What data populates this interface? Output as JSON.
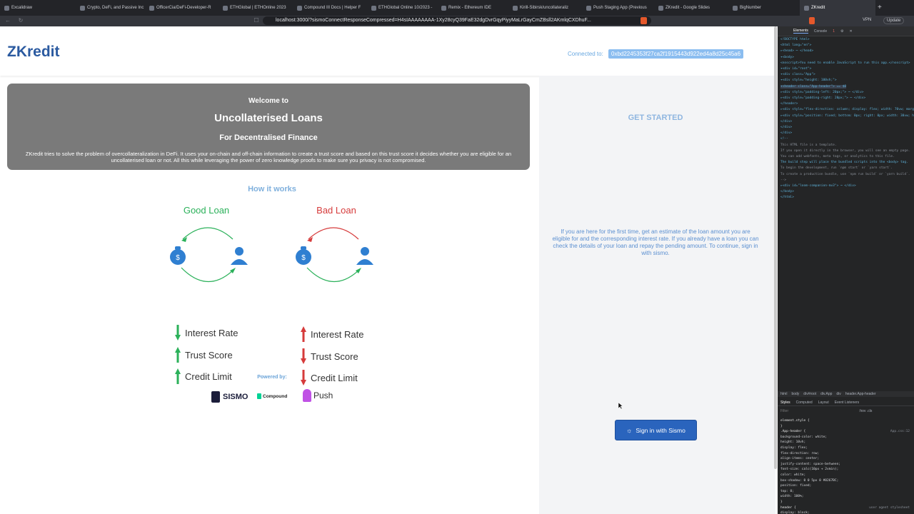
{
  "browser": {
    "tabs": [
      {
        "label": "Excalidraw",
        "active": false
      },
      {
        "label": "Crypto, DeFi, and Passive Inc",
        "active": false
      },
      {
        "label": "OfficerCia/DeFi-Developer-R",
        "active": false
      },
      {
        "label": "ETHGlobal | ETHOnline 2023",
        "active": false
      },
      {
        "label": "Compound III Docs | Helper F",
        "active": false
      },
      {
        "label": "ETHGlobal Online 10/2023 -",
        "active": false
      },
      {
        "label": "Remix - Ethereum IDE",
        "active": false
      },
      {
        "label": "Kirill-Sibirsk/uncollateraliz",
        "active": false
      },
      {
        "label": "Push Staging App (Previous",
        "active": false
      },
      {
        "label": "ZKredit - Google Slides",
        "active": false
      },
      {
        "label": "BigNumber",
        "active": false
      },
      {
        "label": "ZKredit",
        "active": true
      }
    ],
    "new_tab": "+",
    "url": "localhost:3000/?sismoConnectResponseCompressed=H4sIAAAAAAAA-1Xy28cyQ39FaE32dgDvrGqyPiyyMaLrGayCmZBsll2AKmlqCXDhuF...",
    "vpn_label": "VPN",
    "update_label": "Update"
  },
  "app": {
    "logo": "ZKredit",
    "connected_label": "Connected to:",
    "connected_address": "0xbd2245353f27ca2f1915443d922ed4a8d25c45a6",
    "welcome": {
      "pre": "Welcome to",
      "title": "Uncollaterised Loans",
      "subtitle": "For Decentralised Finance",
      "body": "ZKredit tries to solve the problem of overcollateralization in DeFi. It uses your on-chain and off-chain information to create a trust score and based on this trust score it decides whether you are eligible for an uncollaterised loan or not. All this while leveraging the power of zero knowledge proofs to make sure you privacy is not compromised."
    },
    "how_it_works": "How it works",
    "good": {
      "title": "Good Loan",
      "color": "#2bb15a",
      "metrics": [
        {
          "label": "Interest Rate",
          "direction": "down",
          "color": "#2bb15a"
        },
        {
          "label": "Trust Score",
          "direction": "up",
          "color": "#2bb15a"
        },
        {
          "label": "Credit Limit",
          "direction": "up",
          "color": "#2bb15a"
        }
      ]
    },
    "bad": {
      "title": "Bad Loan",
      "color": "#d63b3b",
      "metrics": [
        {
          "label": "Interest Rate",
          "direction": "up",
          "color": "#d63b3b"
        },
        {
          "label": "Trust Score",
          "direction": "down",
          "color": "#d63b3b"
        },
        {
          "label": "Credit Limit",
          "direction": "down",
          "color": "#d63b3b"
        }
      ]
    },
    "powered_by": "Powered by:",
    "sponsors": [
      "SISMO",
      "Compound",
      "Push"
    ],
    "get_started": "GET STARTED",
    "info": "If you are here for the first time, get an estimate of the loan amount you are eligible for and the corresponding interest rate. If you already have a loan you can check the details of your loan and repay the pending amount. To continue, sign in with sismo.",
    "signin": "Sign in with Sismo"
  },
  "devtools": {
    "tabs": [
      "Elements",
      "Console"
    ],
    "error_count": "1",
    "lines": [
      "<!DOCTYPE html>",
      "<html lang=\"en\">",
      "▸<head> ⋯ </head>",
      "▾<body>",
      "  <noscript>You need to enable JavaScript to run this app.</noscript>",
      "  ▾<div id=\"root\">",
      "   ▾<div class=\"App\">",
      "    ▾<div style=\"height: 100vh;\">",
      "     ▾<header class=\"App-header\"> == $0",
      "      ▸<div style=\"padding-left: 20px;\"> ⋯ </div>",
      "      ▸<div style=\"padding-right: 20px;\"> ⋯ </div>",
      "      </header>",
      "     ▸<div style=\"flex-direction: column; display: flex; width: 70vw; margin-top: 10vh;\">",
      "     ▸<div style=\"position: fixed; bottom: 0px; right: 0px; width: 30vw; height: 90vh;\">",
      "     </div>",
      "    </div>",
      "   </div>",
      "  <!--",
      "     This HTML file is a template.",
      "     If you open it directly in the browser, you will see an empty page.",
      "     You can add webfonts, meta tags, or analytics to this file.",
      "     The build step will place the bundled scripts into the <body> tag.",
      "     To begin the development, run `npm start` or `yarn start`.",
      "     To create a production bundle, use `npm run build` or `yarn build`.",
      "  -->",
      "  ▸<div id=\"loom-companion-mv3\"> ⋯ </div>",
      " </body>",
      "</html>"
    ],
    "crumbs": [
      "html",
      "body",
      "div#root",
      "div.App",
      "div",
      "header.App-header"
    ],
    "subtabs": [
      "Styles",
      "Computed",
      "Layout",
      "Event Listeners"
    ],
    "filter": "Filter",
    "filter_opts": ":hov .cls",
    "css": [
      {
        "text": "element.style {",
        "kind": "sel"
      },
      {
        "text": "}",
        "kind": "sel"
      },
      {
        "text": ".App-header {",
        "kind": "sel",
        "src": "App.css:12"
      },
      {
        "text": "  background-color: white;",
        "kind": "prop"
      },
      {
        "text": "  height: 10vh;",
        "kind": "prop"
      },
      {
        "text": "  display: flex;",
        "kind": "prop"
      },
      {
        "text": "  flex-direction: row;",
        "kind": "prop"
      },
      {
        "text": "  align-items: center;",
        "kind": "prop"
      },
      {
        "text": "  justify-content: space-between;",
        "kind": "prop"
      },
      {
        "text": "  font-size: calc(10px + 2vmin);",
        "kind": "prop"
      },
      {
        "text": "  color: white;",
        "kind": "prop"
      },
      {
        "text": "  box-shadow: 0 0 5px 0 #0267BC;",
        "kind": "prop"
      },
      {
        "text": "  position: fixed;",
        "kind": "prop"
      },
      {
        "text": "  top: 0;",
        "kind": "prop"
      },
      {
        "text": "  width: 100%;",
        "kind": "prop"
      },
      {
        "text": "}",
        "kind": "sel"
      },
      {
        "text": "header {",
        "kind": "sel",
        "src": "user agent stylesheet"
      },
      {
        "text": "  display: block;",
        "kind": "prop"
      }
    ]
  }
}
